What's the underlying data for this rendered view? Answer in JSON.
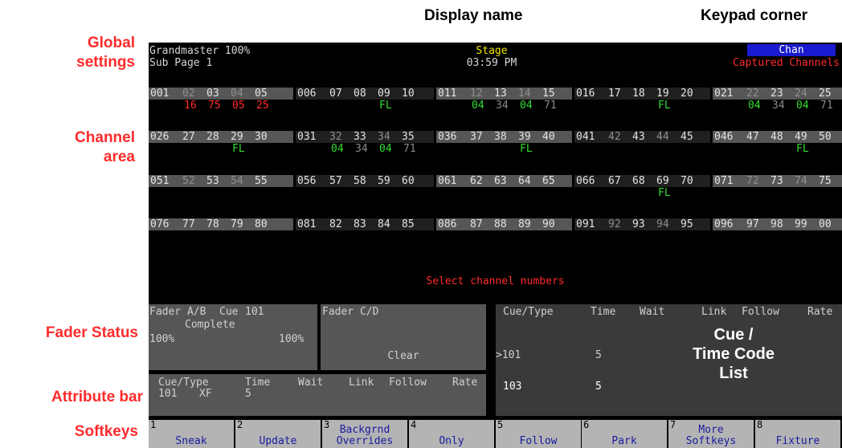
{
  "callouts": {
    "display_name": "Display name",
    "keypad_corner": "Keypad corner",
    "global_settings_1": "Global",
    "global_settings_2": "settings",
    "channel_area_1": "Channel",
    "channel_area_2": "area",
    "fader_status": "Fader Status",
    "attribute_bar": "Attribute bar",
    "softkeys": "Softkeys",
    "cue_list_1": "Cue /",
    "cue_list_2": "Time Code",
    "cue_list_3": "List"
  },
  "header": {
    "grandmaster": "Grandmaster 100%",
    "sub_page": "Sub Page 1",
    "display_name": "Stage",
    "time": "03:59 PM",
    "keypad_mode": "Chan",
    "keypad_status": "Captured Channels"
  },
  "channel_rows": [
    {
      "cells": [
        "001",
        "02",
        "03",
        "04",
        "05",
        "006",
        "07",
        "08",
        "09",
        "10",
        "011",
        "12",
        "13",
        "14",
        "15",
        "016",
        "17",
        "18",
        "19",
        "20",
        "021",
        "22",
        "23",
        "24",
        "25"
      ],
      "dim": [
        1,
        3,
        11,
        13,
        21,
        23
      ],
      "levels": [
        {
          "col": 1,
          "text": "16",
          "color": "red"
        },
        {
          "col": 2,
          "text": "75",
          "color": "red"
        },
        {
          "col": 3,
          "text": "05",
          "color": "red"
        },
        {
          "col": 4,
          "text": "25",
          "color": "red"
        },
        {
          "col": 8,
          "text": "FL",
          "color": "green"
        },
        {
          "col": 11,
          "text": "04",
          "color": "green"
        },
        {
          "col": 12,
          "text": "34",
          "color": "gray"
        },
        {
          "col": 13,
          "text": "04",
          "color": "green"
        },
        {
          "col": 14,
          "text": "71",
          "color": "gray"
        },
        {
          "col": 18,
          "text": "FL",
          "color": "green"
        },
        {
          "col": 21,
          "text": "04",
          "color": "green"
        },
        {
          "col": 22,
          "text": "34",
          "color": "gray"
        },
        {
          "col": 23,
          "text": "04",
          "color": "green"
        },
        {
          "col": 24,
          "text": "71",
          "color": "gray"
        }
      ]
    },
    {
      "cells": [
        "026",
        "27",
        "28",
        "29",
        "30",
        "031",
        "32",
        "33",
        "34",
        "35",
        "036",
        "37",
        "38",
        "39",
        "40",
        "041",
        "42",
        "43",
        "44",
        "45",
        "046",
        "47",
        "48",
        "49",
        "50"
      ],
      "dim": [
        6,
        8,
        16,
        18
      ],
      "levels": [
        {
          "col": 3,
          "text": "FL",
          "color": "green"
        },
        {
          "col": 6,
          "text": "04",
          "color": "green"
        },
        {
          "col": 7,
          "text": "34",
          "color": "gray"
        },
        {
          "col": 8,
          "text": "04",
          "color": "green"
        },
        {
          "col": 9,
          "text": "71",
          "color": "gray"
        },
        {
          "col": 13,
          "text": "FL",
          "color": "green"
        },
        {
          "col": 23,
          "text": "FL",
          "color": "green"
        }
      ]
    },
    {
      "cells": [
        "051",
        "52",
        "53",
        "54",
        "55",
        "056",
        "57",
        "58",
        "59",
        "60",
        "061",
        "62",
        "63",
        "64",
        "65",
        "066",
        "67",
        "68",
        "69",
        "70",
        "071",
        "72",
        "73",
        "74",
        "75"
      ],
      "dim": [
        1,
        3,
        21,
        23
      ],
      "levels": [
        {
          "col": 18,
          "text": "FL",
          "color": "green"
        }
      ]
    },
    {
      "cells": [
        "076",
        "77",
        "78",
        "79",
        "80",
        "081",
        "82",
        "83",
        "84",
        "85",
        "086",
        "87",
        "88",
        "89",
        "90",
        "091",
        "92",
        "93",
        "94",
        "95",
        "096",
        "97",
        "98",
        "99",
        "00"
      ],
      "dim": [
        16,
        18
      ],
      "levels": []
    }
  ],
  "prompt": "Select channel numbers",
  "fader_ab": {
    "label": "Fader A/B",
    "cue_label": "Cue",
    "cue_number": "101",
    "status": "Complete",
    "left_level": "100%",
    "right_level": "100%"
  },
  "fader_cd": {
    "label": "Fader C/D",
    "status": "Clear"
  },
  "attribute_bar": {
    "headers": [
      "Cue/Type",
      "Time",
      "Wait",
      "Link",
      "Follow",
      "Rate"
    ],
    "values": [
      "101",
      "XF",
      "5"
    ]
  },
  "cue_list": {
    "headers": [
      "Cue/Type",
      "Time",
      "Wait",
      "Link",
      "Follow",
      "Rate"
    ],
    "rows": [
      {
        "cue": ">101",
        "time": "5"
      },
      {
        "cue": "103",
        "time": "5"
      }
    ]
  },
  "softkeys": [
    {
      "n": "1",
      "label": "Sneak"
    },
    {
      "n": "2",
      "label": "Update"
    },
    {
      "n": "3",
      "label": "Backgrnd\nOverrides"
    },
    {
      "n": "4",
      "label": "Only"
    },
    {
      "n": "5",
      "label": "Follow"
    },
    {
      "n": "6",
      "label": "Park"
    },
    {
      "n": "7",
      "label": "More\nSoftkeys"
    },
    {
      "n": "8",
      "label": "Fixture"
    }
  ],
  "colors": {
    "screen_bg": "#000000",
    "level_red": "#ff2b2b",
    "level_green": "#33dd33",
    "yellow": "#f2e600",
    "keypad_blue": "#1a1ad0",
    "softkey_bg": "#b4b4b4",
    "softkey_text": "#1a1aa0"
  }
}
